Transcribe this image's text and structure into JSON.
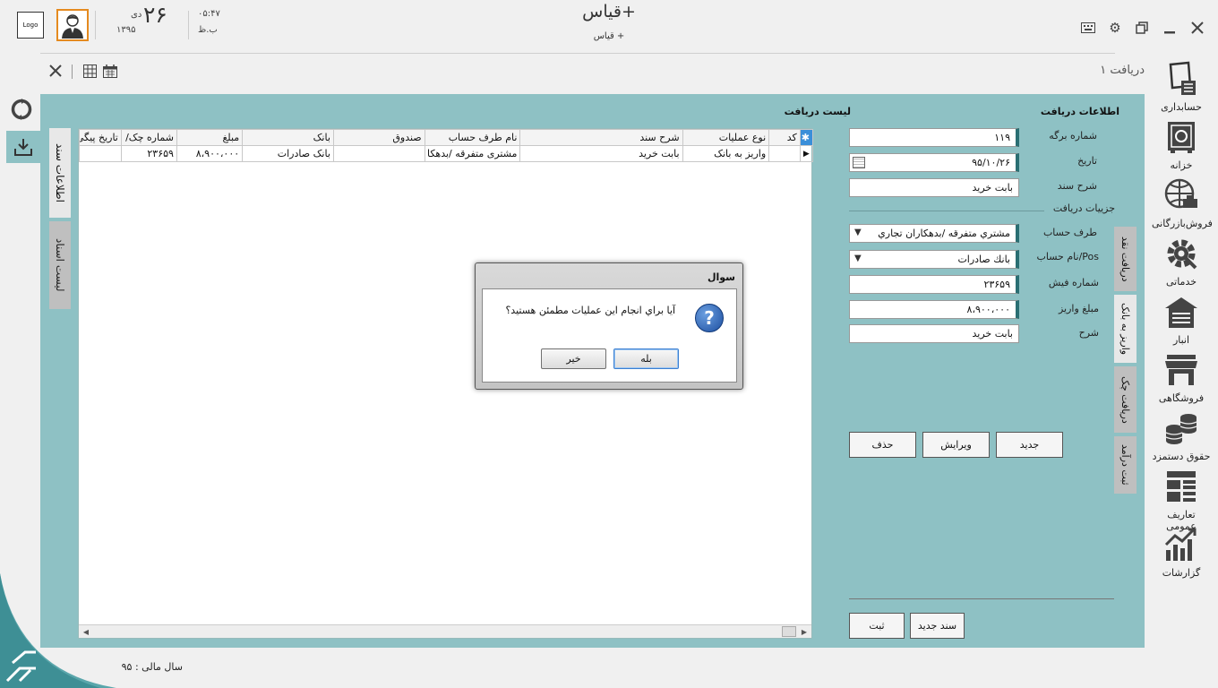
{
  "header": {
    "logo_text": "Logo",
    "date_day": "۲۶",
    "date_month": "دی",
    "date_year": "۱۳۹۵",
    "time": "۰۵:۴۷",
    "ampm": "ب.ظ",
    "app_title": "قیاس+",
    "app_subtitle": "قیاس +",
    "icons": [
      "keyboard-icon",
      "gear-icon",
      "restore-icon",
      "minimize-icon",
      "close-icon"
    ]
  },
  "toolbar": {
    "doc_tab_label": "دریافت ۱",
    "icons": [
      "close-icon",
      "calculator-icon",
      "calendar-icon"
    ]
  },
  "left_tabs": [
    "اطلاعات سند",
    "لیست اسناد"
  ],
  "grid": {
    "title": "لیست دریافت",
    "columns": [
      "کد",
      "نوع عملیات",
      "شرح سند",
      "نام طرف حساب",
      "صندوق",
      "بانک",
      "مبلغ",
      "شماره چک/",
      "تاریخ پیگی"
    ],
    "rows": [
      [
        "",
        "واریز به بانک",
        "بابت خرید",
        "مشتری متفرقه /بدهکا",
        "",
        "بانک صادرات",
        "۸،۹۰۰،۰۰۰",
        "۲۳۶۵۹",
        ""
      ]
    ]
  },
  "form": {
    "title": "اطلاعات دریافت",
    "sheet_no_label": "شماره برگه",
    "sheet_no": "۱۱۹",
    "date_label": "تاریخ",
    "date": "۹۵/۱۰/۲۶",
    "doc_desc_label": "شرح سند",
    "doc_desc": "بابت خرید",
    "details_label": "جزییات دریافت",
    "party_label": "طرف حساب",
    "party": "مشتري متفرقه /بدهكاران تجاري",
    "account_label": "نام حساب/Pos",
    "account": "بانك صادرات",
    "receipt_no_label": "شماره فیش",
    "receipt_no": "۲۳۶۵۹",
    "amount_label": "مبلغ واریز",
    "amount": "۸،۹۰۰،۰۰۰",
    "desc_label": "شرح",
    "desc": "بابت خرید",
    "side_tabs": [
      "دریافت نقد",
      "واریز به بانک",
      "دریافت چک",
      "ثبت درآمد"
    ],
    "buttons": {
      "new": "جدید",
      "edit": "ویرایش",
      "delete": "حذف",
      "save": "ثبت",
      "new_doc": "سند جدید"
    }
  },
  "nav": [
    {
      "label": "حسابداری",
      "icon": "accounting-icon"
    },
    {
      "label": "خزانه",
      "icon": "safe-icon"
    },
    {
      "label": "فروش‌بازرگانی",
      "icon": "globe-trade-icon"
    },
    {
      "label": "خدماتی",
      "icon": "service-gear-icon"
    },
    {
      "label": "انبار",
      "icon": "warehouse-icon"
    },
    {
      "label": "فروشگاهی",
      "icon": "store-icon"
    },
    {
      "label": "حقوق دستمزد",
      "icon": "coins-icon"
    },
    {
      "label": "تعاریف عمومی",
      "icon": "definitions-icon"
    },
    {
      "label": "گزارشات",
      "icon": "reports-icon"
    }
  ],
  "footer": {
    "fiscal_year": "سال مالی : ۹۵"
  },
  "dialog": {
    "title": "سوال",
    "message": "آیا براي انجام این عملیات مطمئن هستید؟",
    "yes": "بله",
    "no": "خیر"
  },
  "colors": {
    "panel": "#8ec1c4",
    "accent": "#2a6f73",
    "avatar_border": "#e58a1f"
  }
}
